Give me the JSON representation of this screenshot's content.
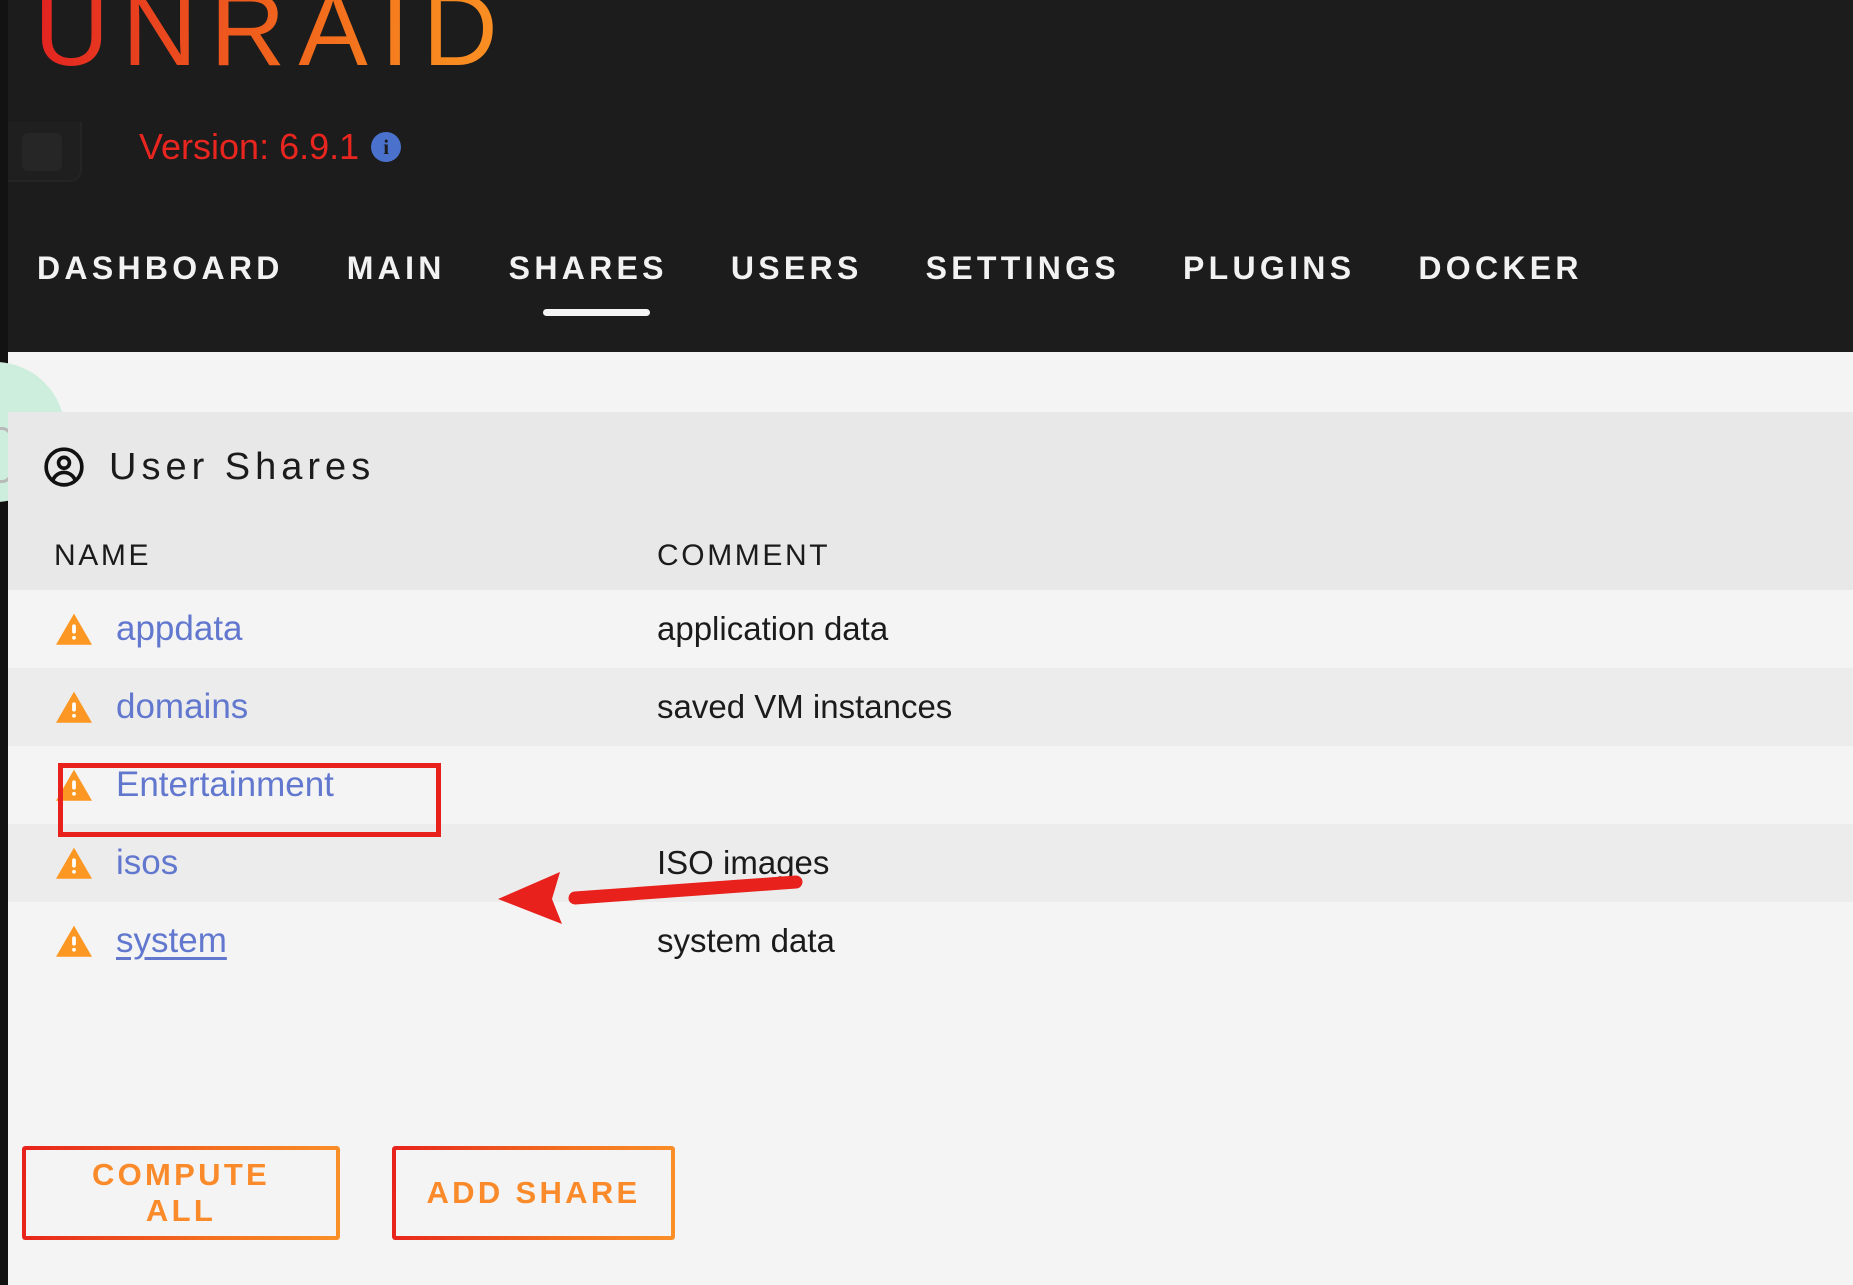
{
  "brand": {
    "logo_text": "UNRAID",
    "version_label": "Version: 6.9.1",
    "info_icon": "info-icon",
    "logo_gradient_from": "#e22121",
    "logo_gradient_to": "#fa9025",
    "version_color": "#e8261f",
    "info_icon_color": "#4a72cc"
  },
  "nav": {
    "items": [
      {
        "label": "Dashboard",
        "active": false
      },
      {
        "label": "Main",
        "active": false
      },
      {
        "label": "Shares",
        "active": true
      },
      {
        "label": "Users",
        "active": false
      },
      {
        "label": "Settings",
        "active": false
      },
      {
        "label": "Plugins",
        "active": false
      },
      {
        "label": "Docker",
        "active": false
      }
    ]
  },
  "section": {
    "icon": "user-circle-icon",
    "title": "User Shares"
  },
  "table": {
    "columns": [
      "Name",
      "Comment"
    ],
    "rows": [
      {
        "icon": "warning-triangle-icon",
        "name": "appdata",
        "comment": "application data",
        "hovered": false,
        "annotated": false
      },
      {
        "icon": "warning-triangle-icon",
        "name": "domains",
        "comment": "saved VM instances",
        "hovered": false,
        "annotated": false
      },
      {
        "icon": "warning-triangle-icon",
        "name": "Entertainment",
        "comment": "",
        "hovered": false,
        "annotated": true
      },
      {
        "icon": "warning-triangle-icon",
        "name": "isos",
        "comment": "ISO images",
        "hovered": false,
        "annotated": false
      },
      {
        "icon": "warning-triangle-icon",
        "name": "system",
        "comment": "system data",
        "hovered": true,
        "annotated": false
      }
    ]
  },
  "buttons": {
    "compute_all": "Compute All",
    "add_share": "Add Share"
  },
  "annotations": {
    "highlight_color": "#e8211c",
    "arrow_color": "#e8211c",
    "target": "Entertainment"
  },
  "colors": {
    "header_bg": "#1c1c1c",
    "content_bg": "#f4f4f4",
    "row_alt_bg": "#ececec",
    "section_bg": "#e8e8e8",
    "link": "#6278cf",
    "warning": "#fb9722",
    "accent_orange": "#fa8a2a"
  }
}
